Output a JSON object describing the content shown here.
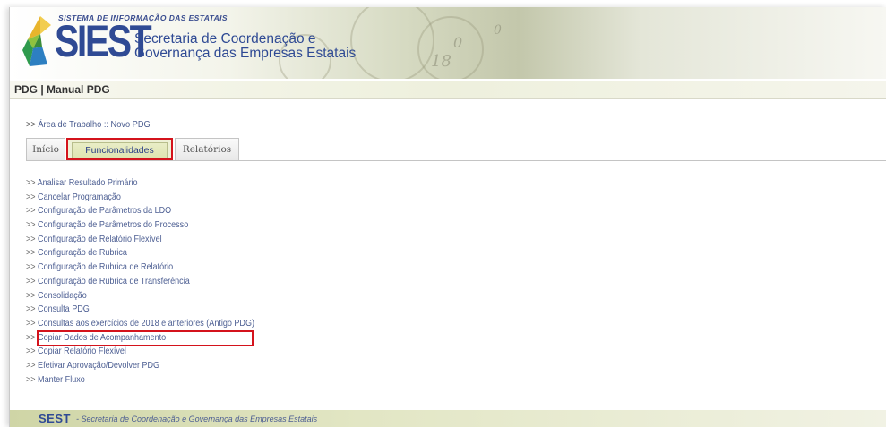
{
  "header": {
    "system_name": "SISTEMA DE INFORMAÇÃO DAS ESTATAIS",
    "logo_text": "SIEST",
    "org_line1": "Secretaria de Coordenação e",
    "org_line2": "Governança das Empresas Estatais"
  },
  "titlebar": {
    "title": "PDG | Manual PDG"
  },
  "breadcrumb": {
    "prefix": ">>",
    "text": "Área de Trabalho :: Novo PDG"
  },
  "tabs": [
    {
      "label": "Início"
    },
    {
      "label": "Funcionalidades",
      "active": true
    },
    {
      "label": "Relatórios"
    }
  ],
  "menu": {
    "prefix": ">>",
    "items": [
      "Analisar Resultado Primário",
      "Cancelar Programação",
      "Configuração de Parâmetros da LDO",
      "Configuração de Parâmetros do Processo",
      "Configuração de Relatório Flexível",
      "Configuração de Rubrica",
      "Configuração de Rubrica de Relatório",
      "Configuração de Rubrica de Transferência",
      "Consolidação",
      "Consulta PDG",
      "Consultas aos exercícios de 2018 e anteriores (Antigo PDG)",
      "Copiar Dados de Acompanhamento",
      "Copiar Relatório Flexível",
      "Efetivar Aprovação/Devolver PDG",
      "Manter Fluxo"
    ]
  },
  "footer": {
    "brand": "SEST",
    "separator": "-",
    "description": "Secretaria de Coordenação e Governança das Empresas Estatais"
  },
  "colors": {
    "brand_blue": "#2f4a94",
    "highlight_red": "#d4131c",
    "link": "#4c5e92"
  }
}
